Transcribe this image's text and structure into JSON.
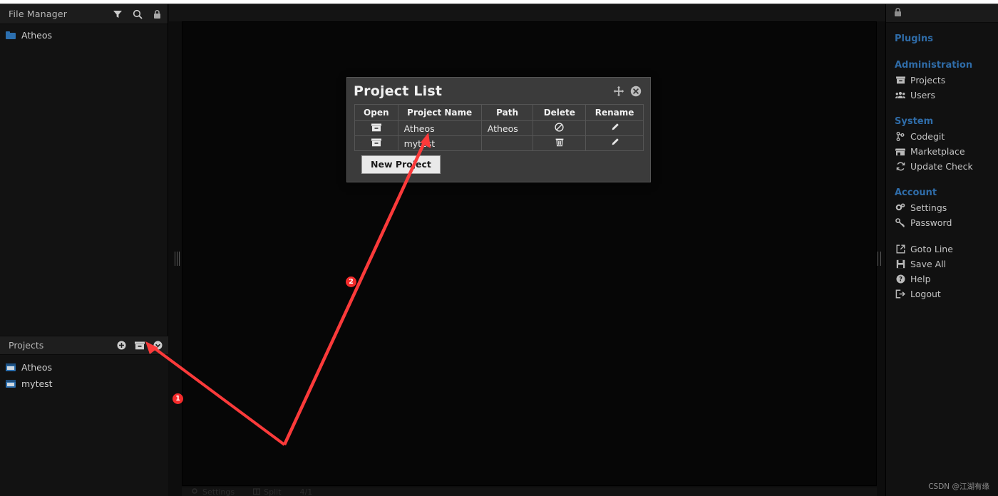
{
  "file_manager": {
    "title": "File Manager",
    "icons": [
      "filter-icon",
      "search-icon",
      "lock-icon"
    ],
    "tree": [
      {
        "label": "Atheos",
        "icon": "folder-icon"
      }
    ]
  },
  "projects_panel": {
    "title": "Projects",
    "icons": [
      "add-icon",
      "archive-icon",
      "chevron-down-icon"
    ],
    "items": [
      {
        "label": "Atheos",
        "icon": "archive-icon"
      },
      {
        "label": "mytest",
        "icon": "archive-icon"
      }
    ]
  },
  "dialog": {
    "title": "Project List",
    "move_icon": "move-icon",
    "close_icon": "close-icon",
    "columns": [
      "Open",
      "Project Name",
      "Path",
      "Delete",
      "Rename"
    ],
    "rows": [
      {
        "open_icon": "archive-icon",
        "name": "Atheos",
        "path": "Atheos",
        "delete_icon": "no-delete-icon",
        "rename_icon": "pencil-icon"
      },
      {
        "open_icon": "archive-icon",
        "name": "mytest",
        "path": "",
        "delete_icon": "trash-icon",
        "rename_icon": "pencil-icon"
      }
    ],
    "new_project_label": "New Project"
  },
  "right_sidebar": {
    "top_icon": "lock-icon",
    "sections": [
      {
        "heading": "Plugins",
        "items": []
      },
      {
        "heading": "Administration",
        "items": [
          {
            "label": "Projects",
            "icon": "archive-icon"
          },
          {
            "label": "Users",
            "icon": "users-icon"
          }
        ]
      },
      {
        "heading": "System",
        "items": [
          {
            "label": "Codegit",
            "icon": "git-branch-icon"
          },
          {
            "label": "Marketplace",
            "icon": "store-icon"
          },
          {
            "label": "Update Check",
            "icon": "refresh-icon"
          }
        ]
      },
      {
        "heading": "Account",
        "items": [
          {
            "label": "Settings",
            "icon": "gears-icon"
          },
          {
            "label": "Password",
            "icon": "key-icon"
          }
        ]
      },
      {
        "heading": "",
        "items": [
          {
            "label": "Goto Line",
            "icon": "external-link-icon"
          },
          {
            "label": "Save All",
            "icon": "save-icon"
          },
          {
            "label": "Help",
            "icon": "question-circle-icon"
          },
          {
            "label": "Logout",
            "icon": "logout-icon"
          }
        ]
      }
    ]
  },
  "status_bar": {
    "items": [
      {
        "label": "Settings",
        "icon": "gears-icon"
      },
      {
        "label": "Split",
        "icon": "split-icon"
      },
      {
        "label": "4/1",
        "icon": ""
      }
    ]
  },
  "annotations": {
    "markers": [
      {
        "number": "1"
      },
      {
        "number": "2"
      }
    ],
    "color": "#f42b2b"
  },
  "watermark": "CSDN @江湖有缘",
  "colors": {
    "accent_blue": "#2f6ca8",
    "folder_blue": "#2c6faf",
    "annotation_red": "#f42b2b",
    "panel_bg": "#121212",
    "editor_bg": "#060606",
    "dialog_bg": "#3b3b3b"
  }
}
